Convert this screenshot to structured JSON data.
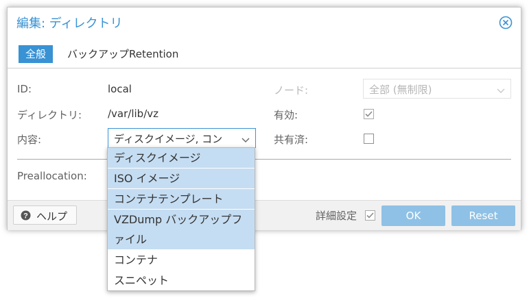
{
  "dialog": {
    "title": "編集: ディレクトリ",
    "close_icon": "circle-x-icon"
  },
  "tabs": [
    {
      "label": "全般",
      "active": true
    },
    {
      "label": "バックアップRetention",
      "active": false
    }
  ],
  "form": {
    "id_label": "ID:",
    "id_value": "local",
    "directory_label": "ディレクトリ:",
    "directory_value": "/var/lib/vz",
    "content_label": "内容:",
    "content_value": "ディスクイメージ, コン",
    "node_label": "ノード:",
    "node_value": "全部 (無制限)",
    "enabled_label": "有効:",
    "enabled_checked": true,
    "shared_label": "共有済:",
    "shared_checked": false,
    "preallocation_label": "Preallocation:"
  },
  "dropdown": {
    "options": [
      {
        "label": "ディスクイメージ",
        "selected": true
      },
      {
        "label": "ISO イメージ",
        "selected": true
      },
      {
        "label": "コンテナテンプレート",
        "selected": true
      },
      {
        "label": "VZDump バックアップフ",
        "selected": true
      },
      {
        "label": "ァイル",
        "selected": true
      },
      {
        "label": "コンテナ",
        "selected": false
      },
      {
        "label": "スニペット",
        "selected": false
      }
    ]
  },
  "footer": {
    "help_label": "ヘルプ",
    "advanced_label": "詳細設定",
    "advanced_checked": true,
    "ok_label": "OK",
    "reset_label": "Reset"
  },
  "colors": {
    "accent": "#3892d4",
    "button_disabled": "#8ec1e5",
    "selected_option": "#c5ddf2"
  }
}
